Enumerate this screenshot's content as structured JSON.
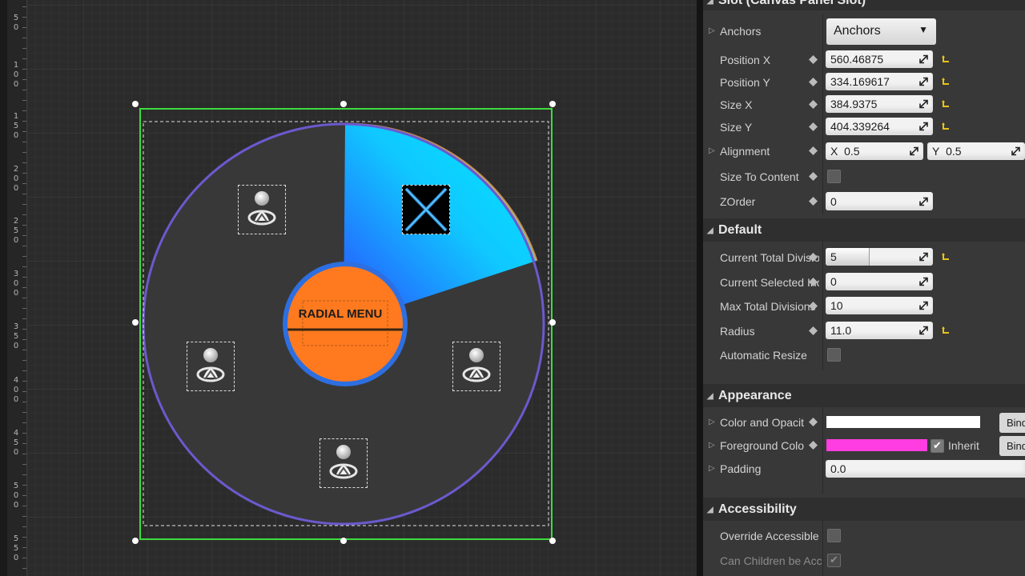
{
  "ruler": {
    "labels": [
      {
        "digits": [
          "5",
          "0"
        ]
      },
      {
        "digits": [
          "1",
          "0",
          "0"
        ]
      },
      {
        "digits": [
          "1",
          "5",
          "0"
        ]
      },
      {
        "digits": [
          "2",
          "0",
          "0"
        ]
      },
      {
        "digits": [
          "2",
          "5",
          "0"
        ]
      },
      {
        "digits": [
          "3",
          "0",
          "0"
        ]
      },
      {
        "digits": [
          "3",
          "5",
          "0"
        ]
      },
      {
        "digits": [
          "4",
          "0",
          "0"
        ]
      },
      {
        "digits": [
          "4",
          "5",
          "0"
        ]
      },
      {
        "digits": [
          "5",
          "0",
          "0"
        ]
      },
      {
        "digits": [
          "5",
          "5",
          "0"
        ]
      }
    ]
  },
  "designer": {
    "widget": {
      "center_title": "RADIAL MENU",
      "selection_color": "#3ddc3d",
      "ring_color": "#6a5acd",
      "center_color": "#ff7a1f",
      "center_ring_color": "#2d6fe0",
      "segment_gradient": [
        "#00e8ff",
        "#2a5cff"
      ],
      "slot_icons": [
        "person-marker-icon",
        "close-x-icon",
        "person-marker-icon",
        "person-marker-icon",
        "person-marker-icon"
      ]
    }
  },
  "details": {
    "slot_section": {
      "title": "Slot (Canvas Panel Slot)"
    },
    "anchors": {
      "label": "Anchors",
      "value": "Anchors"
    },
    "rows_slot": [
      {
        "label": "Position X",
        "value": "560.46875",
        "reset": true
      },
      {
        "label": "Position Y",
        "value": "334.169617",
        "reset": true
      },
      {
        "label": "Size X",
        "value": "384.9375",
        "reset": true
      },
      {
        "label": "Size Y",
        "value": "404.339264",
        "reset": true
      }
    ],
    "alignment": {
      "label": "Alignment",
      "x_label": "X",
      "x_value": "0.5",
      "y_label": "Y",
      "y_value": "0.5"
    },
    "size_to_content": {
      "label": "Size To Content",
      "checked": false
    },
    "zorder": {
      "label": "ZOrder",
      "value": "0"
    },
    "default_section": {
      "title": "Default",
      "rows": [
        {
          "label": "Current Total Divisio",
          "value": "5",
          "reset": true,
          "fill": 0.4
        },
        {
          "label": "Current Selected Inc",
          "value": "0",
          "reset": false
        },
        {
          "label": "Max Total Divisions",
          "value": "10",
          "reset": false
        },
        {
          "label": "Radius",
          "value": "11.0",
          "reset": true
        }
      ],
      "automatic_resize": {
        "label": "Automatic Resize",
        "checked": false
      }
    },
    "appearance_section": {
      "title": "Appearance",
      "color_opacity": {
        "label": "Color and Opacit",
        "color": "#ffffff",
        "bind": "Bind"
      },
      "foreground": {
        "label": "Foreground Colo",
        "color": "#ff3de0",
        "inherit_label": "Inherit",
        "inherit_checked": true,
        "bind": "Bind"
      },
      "padding": {
        "label": "Padding",
        "value": "0.0"
      }
    },
    "accessibility_section": {
      "title": "Accessibility",
      "override": {
        "label": "Override Accessible",
        "checked": false
      },
      "children": {
        "label": "Can Children be Acc",
        "checked": true
      }
    }
  }
}
